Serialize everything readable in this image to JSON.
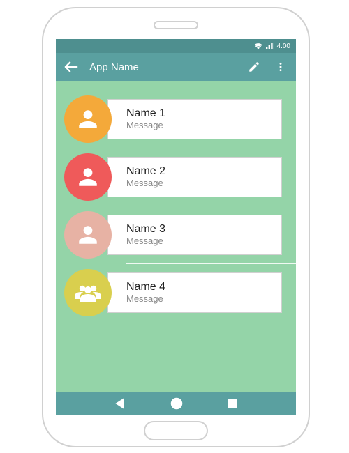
{
  "status": {
    "time": "4.00"
  },
  "appbar": {
    "title": "App Name"
  },
  "contacts": [
    {
      "name": "Name 1",
      "message": "Message",
      "avatar_color": "#f4a93a",
      "icon": "person"
    },
    {
      "name": "Name 2",
      "message": "Message",
      "avatar_color": "#ef5a5a",
      "icon": "person"
    },
    {
      "name": "Name 3",
      "message": "Message",
      "avatar_color": "#e7b2a4",
      "icon": "person"
    },
    {
      "name": "Name 4",
      "message": "Message",
      "avatar_color": "#d9cf4e",
      "icon": "group"
    }
  ]
}
